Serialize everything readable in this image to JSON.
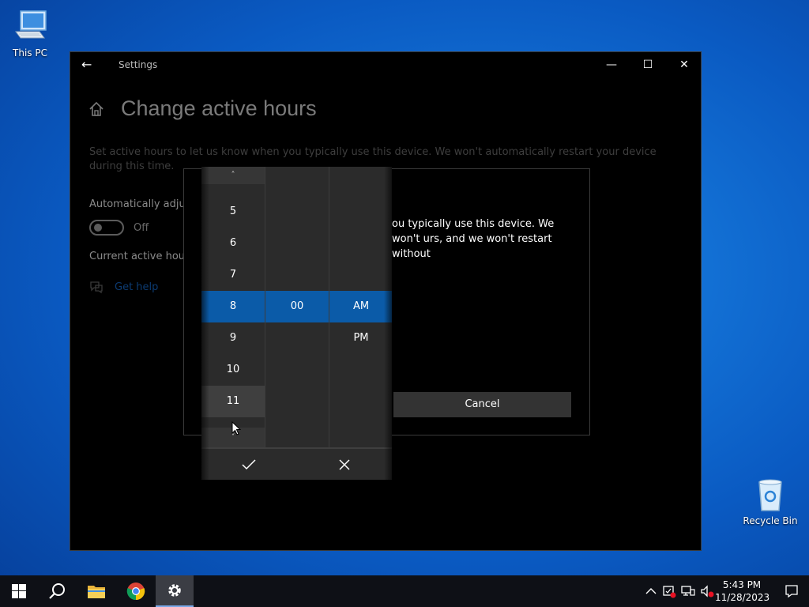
{
  "desktop": {
    "icons": [
      {
        "label": "This PC",
        "icon": "computer-icon"
      },
      {
        "label": "Recycle Bin",
        "icon": "recycle-bin-icon"
      }
    ]
  },
  "window": {
    "title": "Settings",
    "page_title": "Change active hours",
    "description": "Set active hours to let us know when you typically use this device. We won't automatically restart your device during this time.",
    "auto_adjust_label": "Automatically adjus",
    "toggle_state": "Off",
    "current_hours_label": "Current active hour",
    "get_help": "Get help"
  },
  "dialog": {
    "text": "ou typically use this device. We won't urs, and we won't restart without",
    "cancel_label": "Cancel"
  },
  "time_picker": {
    "hours": [
      "5",
      "6",
      "7",
      "8",
      "9",
      "10",
      "11"
    ],
    "selected_hour": "8",
    "hovered_hour": "11",
    "minutes": [
      "00"
    ],
    "periods": [
      "AM",
      "PM"
    ],
    "selected_period": "AM",
    "up_arrow": "˄",
    "down_arrow": "˅"
  },
  "taskbar": {
    "time": "5:43 PM",
    "date": "11/28/2023",
    "accent": "#0b5ba8"
  }
}
